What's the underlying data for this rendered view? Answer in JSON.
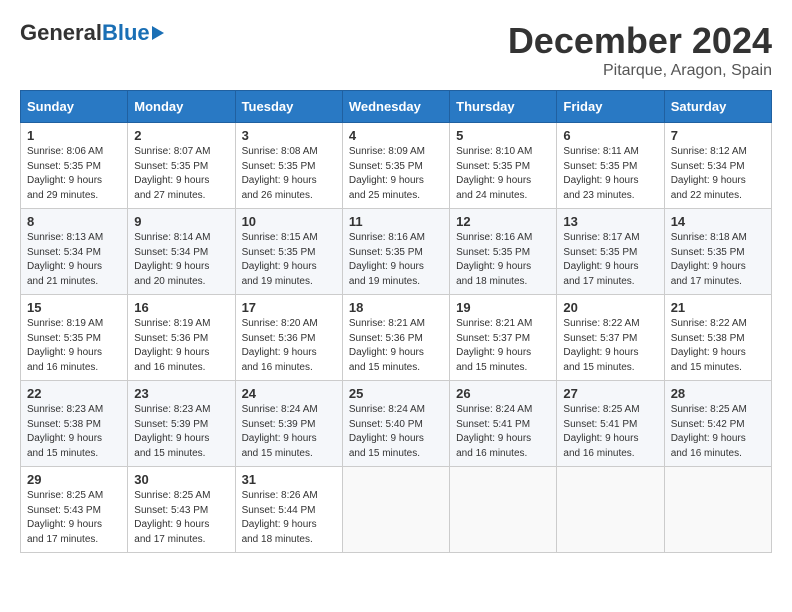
{
  "header": {
    "logo_general": "General",
    "logo_blue": "Blue",
    "title": "December 2024",
    "subtitle": "Pitarque, Aragon, Spain"
  },
  "days_of_week": [
    "Sunday",
    "Monday",
    "Tuesday",
    "Wednesday",
    "Thursday",
    "Friday",
    "Saturday"
  ],
  "weeks": [
    [
      {
        "day": "1",
        "sunrise": "8:06 AM",
        "sunset": "5:35 PM",
        "daylight": "9 hours and 29 minutes."
      },
      {
        "day": "2",
        "sunrise": "8:07 AM",
        "sunset": "5:35 PM",
        "daylight": "9 hours and 27 minutes."
      },
      {
        "day": "3",
        "sunrise": "8:08 AM",
        "sunset": "5:35 PM",
        "daylight": "9 hours and 26 minutes."
      },
      {
        "day": "4",
        "sunrise": "8:09 AM",
        "sunset": "5:35 PM",
        "daylight": "9 hours and 25 minutes."
      },
      {
        "day": "5",
        "sunrise": "8:10 AM",
        "sunset": "5:35 PM",
        "daylight": "9 hours and 24 minutes."
      },
      {
        "day": "6",
        "sunrise": "8:11 AM",
        "sunset": "5:35 PM",
        "daylight": "9 hours and 23 minutes."
      },
      {
        "day": "7",
        "sunrise": "8:12 AM",
        "sunset": "5:34 PM",
        "daylight": "9 hours and 22 minutes."
      }
    ],
    [
      {
        "day": "8",
        "sunrise": "8:13 AM",
        "sunset": "5:34 PM",
        "daylight": "9 hours and 21 minutes."
      },
      {
        "day": "9",
        "sunrise": "8:14 AM",
        "sunset": "5:34 PM",
        "daylight": "9 hours and 20 minutes."
      },
      {
        "day": "10",
        "sunrise": "8:15 AM",
        "sunset": "5:35 PM",
        "daylight": "9 hours and 19 minutes."
      },
      {
        "day": "11",
        "sunrise": "8:16 AM",
        "sunset": "5:35 PM",
        "daylight": "9 hours and 19 minutes."
      },
      {
        "day": "12",
        "sunrise": "8:16 AM",
        "sunset": "5:35 PM",
        "daylight": "9 hours and 18 minutes."
      },
      {
        "day": "13",
        "sunrise": "8:17 AM",
        "sunset": "5:35 PM",
        "daylight": "9 hours and 17 minutes."
      },
      {
        "day": "14",
        "sunrise": "8:18 AM",
        "sunset": "5:35 PM",
        "daylight": "9 hours and 17 minutes."
      }
    ],
    [
      {
        "day": "15",
        "sunrise": "8:19 AM",
        "sunset": "5:35 PM",
        "daylight": "9 hours and 16 minutes."
      },
      {
        "day": "16",
        "sunrise": "8:19 AM",
        "sunset": "5:36 PM",
        "daylight": "9 hours and 16 minutes."
      },
      {
        "day": "17",
        "sunrise": "8:20 AM",
        "sunset": "5:36 PM",
        "daylight": "9 hours and 16 minutes."
      },
      {
        "day": "18",
        "sunrise": "8:21 AM",
        "sunset": "5:36 PM",
        "daylight": "9 hours and 15 minutes."
      },
      {
        "day": "19",
        "sunrise": "8:21 AM",
        "sunset": "5:37 PM",
        "daylight": "9 hours and 15 minutes."
      },
      {
        "day": "20",
        "sunrise": "8:22 AM",
        "sunset": "5:37 PM",
        "daylight": "9 hours and 15 minutes."
      },
      {
        "day": "21",
        "sunrise": "8:22 AM",
        "sunset": "5:38 PM",
        "daylight": "9 hours and 15 minutes."
      }
    ],
    [
      {
        "day": "22",
        "sunrise": "8:23 AM",
        "sunset": "5:38 PM",
        "daylight": "9 hours and 15 minutes."
      },
      {
        "day": "23",
        "sunrise": "8:23 AM",
        "sunset": "5:39 PM",
        "daylight": "9 hours and 15 minutes."
      },
      {
        "day": "24",
        "sunrise": "8:24 AM",
        "sunset": "5:39 PM",
        "daylight": "9 hours and 15 minutes."
      },
      {
        "day": "25",
        "sunrise": "8:24 AM",
        "sunset": "5:40 PM",
        "daylight": "9 hours and 15 minutes."
      },
      {
        "day": "26",
        "sunrise": "8:24 AM",
        "sunset": "5:41 PM",
        "daylight": "9 hours and 16 minutes."
      },
      {
        "day": "27",
        "sunrise": "8:25 AM",
        "sunset": "5:41 PM",
        "daylight": "9 hours and 16 minutes."
      },
      {
        "day": "28",
        "sunrise": "8:25 AM",
        "sunset": "5:42 PM",
        "daylight": "9 hours and 16 minutes."
      }
    ],
    [
      {
        "day": "29",
        "sunrise": "8:25 AM",
        "sunset": "5:43 PM",
        "daylight": "9 hours and 17 minutes."
      },
      {
        "day": "30",
        "sunrise": "8:25 AM",
        "sunset": "5:43 PM",
        "daylight": "9 hours and 17 minutes."
      },
      {
        "day": "31",
        "sunrise": "8:26 AM",
        "sunset": "5:44 PM",
        "daylight": "9 hours and 18 minutes."
      },
      null,
      null,
      null,
      null
    ]
  ],
  "labels": {
    "sunrise": "Sunrise: ",
    "sunset": "Sunset: ",
    "daylight": "Daylight: "
  }
}
